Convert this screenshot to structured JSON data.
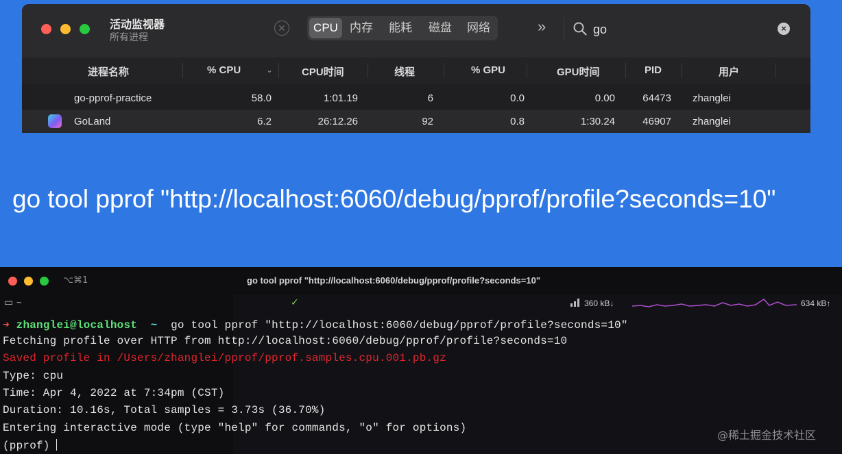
{
  "activity_monitor": {
    "title": "活动监视器",
    "subtitle": "所有进程",
    "tabs": [
      {
        "label": "CPU",
        "active": true
      },
      {
        "label": "内存",
        "active": false
      },
      {
        "label": "能耗",
        "active": false
      },
      {
        "label": "磁盘",
        "active": false
      },
      {
        "label": "网络",
        "active": false
      }
    ],
    "more_label": "»",
    "search_value": "go",
    "stop_icon": "x-circle-icon",
    "columns": [
      "进程名称",
      "% CPU",
      "CPU时间",
      "线程",
      "% GPU",
      "GPU时间",
      "PID",
      "用户"
    ],
    "rows": [
      {
        "name": "go-pprof-practice",
        "cpu": "58.0",
        "cpu_time": "1:01.19",
        "threads": "6",
        "gpu": "0.0",
        "gpu_time": "0.00",
        "pid": "64473",
        "user": "zhanglei"
      },
      {
        "name": "GoLand",
        "cpu": "6.2",
        "cpu_time": "26:12.26",
        "threads": "92",
        "gpu": "0.8",
        "gpu_time": "1:30.24",
        "pid": "46907",
        "user": "zhanglei"
      }
    ]
  },
  "big_command": "go tool pprof \"http://localhost:6060/debug/pprof/profile?seconds=10\"",
  "terminal": {
    "shortcut": "⌥⌘1",
    "title": "go tool pprof \"http://localhost:6060/debug/pprof/profile?seconds=10\"",
    "tab_label": "~",
    "net_down": "360 kB↓",
    "net_up": "634 kB↑",
    "prompt_arrow": "➜",
    "prompt_user": "zhanglei@localhost",
    "prompt_dir": "~",
    "command": "go tool pprof \"http://localhost:6060/debug/pprof/profile?seconds=10\"",
    "lines": [
      "Fetching profile over HTTP from http://localhost:6060/debug/pprof/profile?seconds=10",
      "Saved profile in /Users/zhanglei/pprof/pprof.samples.cpu.001.pb.gz",
      "Type: cpu",
      "Time: Apr 4, 2022 at 7:34pm (CST)",
      "Duration: 10.16s, Total samples = 3.73s (36.70%)",
      "Entering interactive mode (type \"help\" for commands, \"o\" for options)",
      "(pprof) "
    ]
  },
  "watermark": "@稀土掘金技术社区",
  "colors": {
    "background": "#2f78e3",
    "terminal_error": "#e0252e",
    "prompt_user": "#5ee07a"
  }
}
